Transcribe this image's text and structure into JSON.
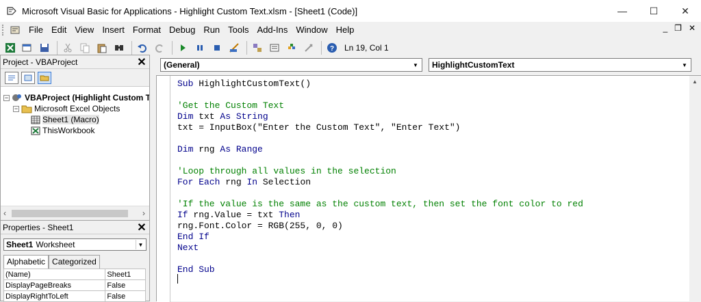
{
  "window": {
    "title": "Microsoft Visual Basic for Applications - Highlight Custom Text.xlsm - [Sheet1 (Code)]",
    "minimize": "—",
    "maximize": "☐",
    "close": "✕"
  },
  "menu": {
    "items": [
      "File",
      "Edit",
      "View",
      "Insert",
      "Format",
      "Debug",
      "Run",
      "Tools",
      "Add-Ins",
      "Window",
      "Help"
    ],
    "mdi_min": "_",
    "mdi_restore": "❐",
    "mdi_close": "✕"
  },
  "toolbar": {
    "position": "Ln 19, Col 1"
  },
  "project": {
    "title": "Project - VBAProject",
    "close": "✕",
    "root": "VBAProject (Highlight Custom T",
    "folder": "Microsoft Excel Objects",
    "sheet": "Sheet1 (Macro)",
    "workbook": "ThisWorkbook"
  },
  "properties": {
    "title": "Properties - Sheet1",
    "close": "✕",
    "object_name": "Sheet1",
    "object_type": "Worksheet",
    "tab_alpha": "Alphabetic",
    "tab_cat": "Categorized",
    "rows": [
      {
        "name": "(Name)",
        "value": "Sheet1"
      },
      {
        "name": "DisplayPageBreaks",
        "value": "False"
      },
      {
        "name": "DisplayRightToLeft",
        "value": "False"
      }
    ]
  },
  "code": {
    "object_combo": "(General)",
    "proc_combo": "HighlightCustomText",
    "lines": [
      "Sub HighlightCustomText()",
      "",
      "'Get the Custom Text",
      "Dim txt As String",
      "txt = InputBox(\"Enter the Custom Text\", \"Enter Text\")",
      "",
      "Dim rng As Range",
      "",
      "'Loop through all values in the selection",
      "For Each rng In Selection",
      "",
      "'If the value is the same as the custom text, then set the font color to red",
      "If rng.Value = txt Then",
      "rng.Font.Color = RGB(255, 0, 0)",
      "End If",
      "Next",
      "",
      "End Sub"
    ]
  },
  "colors": {
    "keyword": "#00008b",
    "comment": "#008000"
  }
}
